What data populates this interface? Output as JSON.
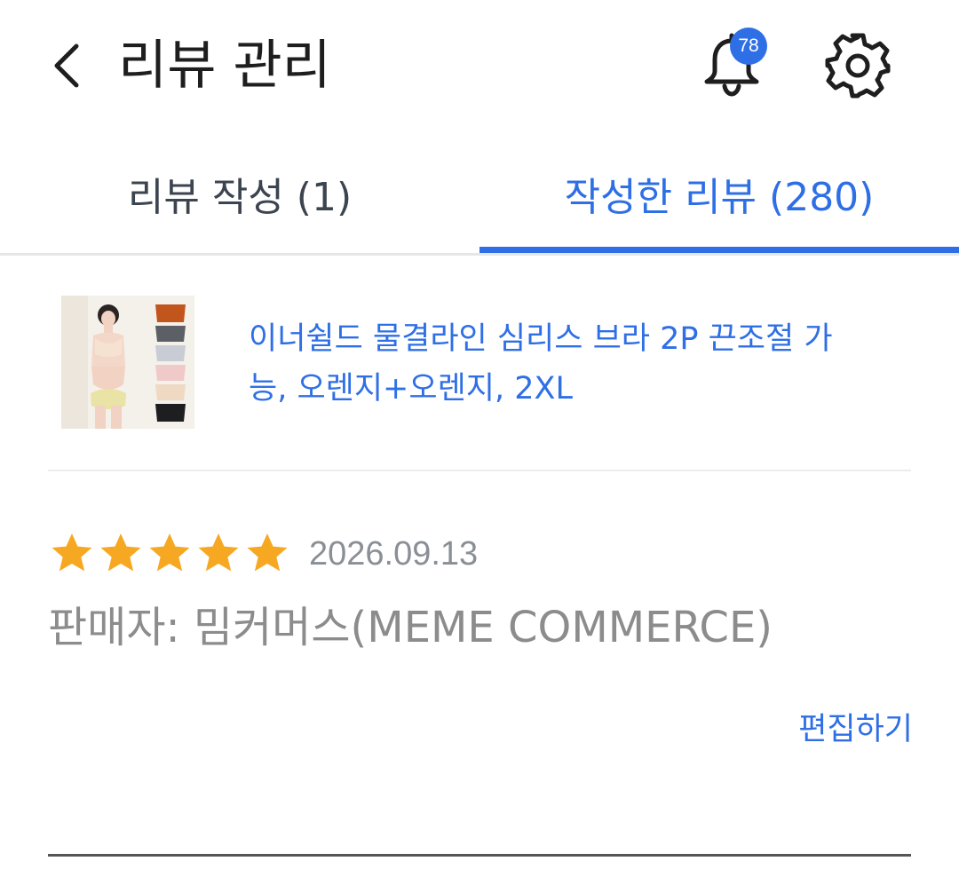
{
  "header": {
    "title": "리뷰 관리",
    "notification_count": "78",
    "back_icon": "chevron-left-icon",
    "bell_icon": "bell-icon",
    "settings_icon": "gear-icon"
  },
  "tabs": [
    {
      "label": "리뷰 작성 (1)",
      "active": false
    },
    {
      "label": "작성한 리뷰 (280)",
      "active": true
    }
  ],
  "product": {
    "name": "이너쉴드 물결라인 심리스 브라 2P 끈조절 가능, 오렌지+오렌지, 2XL",
    "thumbnail_icon": "product-thumbnail"
  },
  "review": {
    "rating": 5,
    "rating_max": 5,
    "date": "2026.09.13",
    "seller": "판매자: 밈커머스(MEME COMMERCE)",
    "edit_label": "편집하기"
  },
  "colors": {
    "accent": "#2f6fe6",
    "star": "#f7a823",
    "muted_text": "#8c8c8c"
  }
}
